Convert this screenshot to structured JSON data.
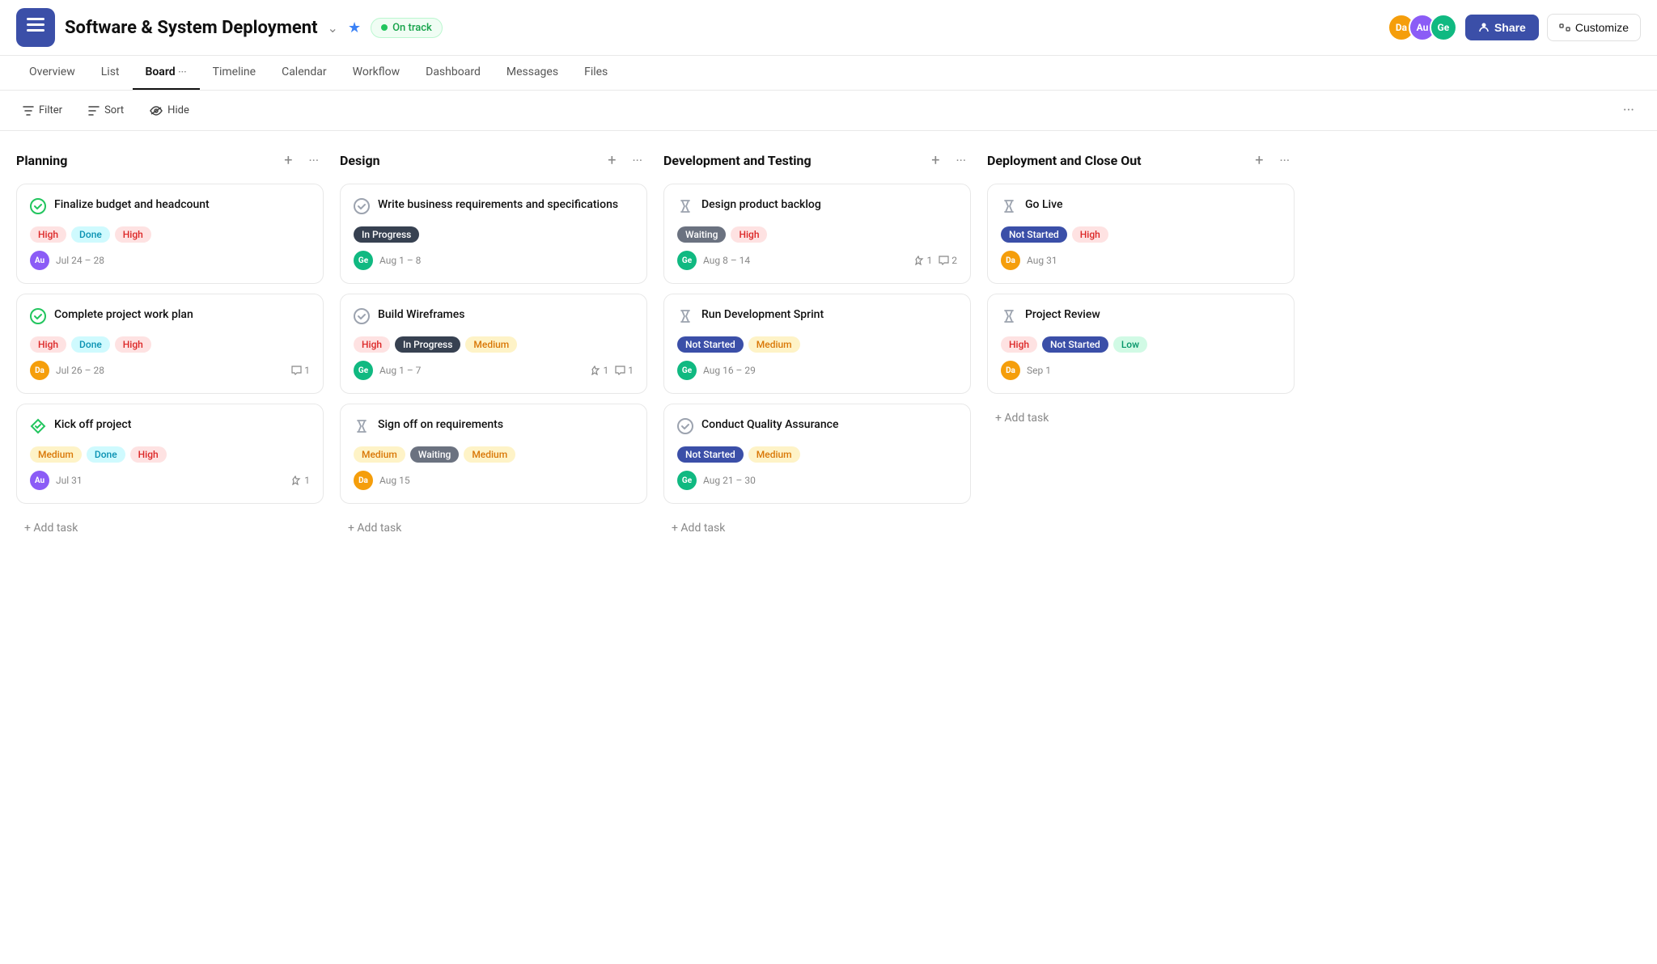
{
  "header": {
    "menu_label": "☰",
    "title": "Software & System Deployment",
    "title_arrow": "⌄",
    "star": "★",
    "status_label": "On track",
    "share_label": "Share",
    "customize_label": "Customize",
    "share_icon": "👤"
  },
  "nav": {
    "tabs": [
      "Overview",
      "List",
      "Board",
      "Timeline",
      "Calendar",
      "Workflow",
      "Dashboard",
      "Messages",
      "Files"
    ],
    "active": "Board",
    "more": "···"
  },
  "toolbar": {
    "filter_label": "Filter",
    "sort_label": "Sort",
    "hide_label": "Hide",
    "more": "···"
  },
  "columns": [
    {
      "id": "planning",
      "title": "Planning",
      "cards": [
        {
          "id": "card-1",
          "icon": "✅",
          "icon_type": "check-circle",
          "title": "Finalize budget and headcount",
          "tags": [
            "High",
            "Done",
            "High"
          ],
          "tag_types": [
            "high",
            "done",
            "high"
          ],
          "avatar": "Au",
          "avatar_color": "purple",
          "date": "Jul 24 – 28",
          "likes": null,
          "comments": null
        },
        {
          "id": "card-2",
          "icon": "✅",
          "icon_type": "check-circle",
          "title": "Complete project work plan",
          "tags": [
            "High",
            "Done",
            "High"
          ],
          "tag_types": [
            "high",
            "done",
            "high"
          ],
          "avatar": "Da",
          "avatar_color": "amber",
          "date": "Jul 26 – 28",
          "likes": null,
          "comments": 1
        },
        {
          "id": "card-3",
          "icon": "💎",
          "icon_type": "diamond-check",
          "title": "Kick off project",
          "tags": [
            "Medium",
            "Done",
            "High"
          ],
          "tag_types": [
            "medium",
            "done",
            "high"
          ],
          "avatar": "Au",
          "avatar_color": "purple",
          "date": "Jul 31",
          "likes": 1,
          "comments": null
        }
      ],
      "add_task_label": "+ Add task"
    },
    {
      "id": "design",
      "title": "Design",
      "cards": [
        {
          "id": "card-4",
          "icon": "⊘",
          "icon_type": "circle-check",
          "title": "Write business requirements and specifications",
          "tags": [
            "In Progress"
          ],
          "tag_types": [
            "in-progress"
          ],
          "avatar": "Ge",
          "avatar_color": "green",
          "date": "Aug 1 – 8",
          "likes": null,
          "comments": null
        },
        {
          "id": "card-5",
          "icon": "⊘",
          "icon_type": "circle-check",
          "title": "Build Wireframes",
          "tags": [
            "High",
            "In Progress",
            "Medium"
          ],
          "tag_types": [
            "high",
            "in-progress",
            "medium"
          ],
          "avatar": "Ge",
          "avatar_color": "green",
          "date": "Aug 1 – 7",
          "likes": 1,
          "comments": 1
        },
        {
          "id": "card-6",
          "icon": "⏳",
          "icon_type": "hourglass",
          "title": "Sign off on requirements",
          "tags": [
            "Medium",
            "Waiting",
            "Medium"
          ],
          "tag_types": [
            "medium",
            "waiting",
            "medium"
          ],
          "avatar": "Da",
          "avatar_color": "amber",
          "date": "Aug 15",
          "likes": null,
          "comments": null
        }
      ],
      "add_task_label": "+ Add task"
    },
    {
      "id": "dev-testing",
      "title": "Development and Testing",
      "cards": [
        {
          "id": "card-7",
          "icon": "⏳",
          "icon_type": "hourglass",
          "title": "Design product backlog",
          "tags": [
            "Waiting",
            "High"
          ],
          "tag_types": [
            "waiting",
            "high"
          ],
          "avatar": "Ge",
          "avatar_color": "green",
          "date": "Aug 8 – 14",
          "likes": 1,
          "comments": 2
        },
        {
          "id": "card-8",
          "icon": "⏳",
          "icon_type": "hourglass",
          "title": "Run Development Sprint",
          "tags": [
            "Not Started",
            "Medium"
          ],
          "tag_types": [
            "not-started",
            "medium"
          ],
          "avatar": "Ge",
          "avatar_color": "green",
          "date": "Aug 16 – 29",
          "likes": null,
          "comments": null
        },
        {
          "id": "card-9",
          "icon": "⊘",
          "icon_type": "circle-check",
          "title": "Conduct Quality Assurance",
          "tags": [
            "Not Started",
            "Medium"
          ],
          "tag_types": [
            "not-started",
            "medium"
          ],
          "avatar": "Ge",
          "avatar_color": "green",
          "date": "Aug 21 – 30",
          "likes": null,
          "comments": null
        }
      ],
      "add_task_label": "+ Add task"
    },
    {
      "id": "deployment",
      "title": "Deployment and Close Out",
      "cards": [
        {
          "id": "card-10",
          "icon": "⏳",
          "icon_type": "hourglass",
          "title": "Go Live",
          "tags": [
            "Not Started",
            "High"
          ],
          "tag_types": [
            "not-started",
            "high"
          ],
          "avatar": "Da",
          "avatar_color": "amber",
          "date": "Aug 31",
          "likes": null,
          "comments": null
        },
        {
          "id": "card-11",
          "icon": "⏳",
          "icon_type": "hourglass",
          "title": "Project Review",
          "tags": [
            "High",
            "Not Started",
            "Low"
          ],
          "tag_types": [
            "high",
            "not-started",
            "low"
          ],
          "avatar": "Da",
          "avatar_color": "amber",
          "date": "Sep 1",
          "likes": null,
          "comments": null
        }
      ],
      "add_task_label": "+ Add task"
    }
  ]
}
